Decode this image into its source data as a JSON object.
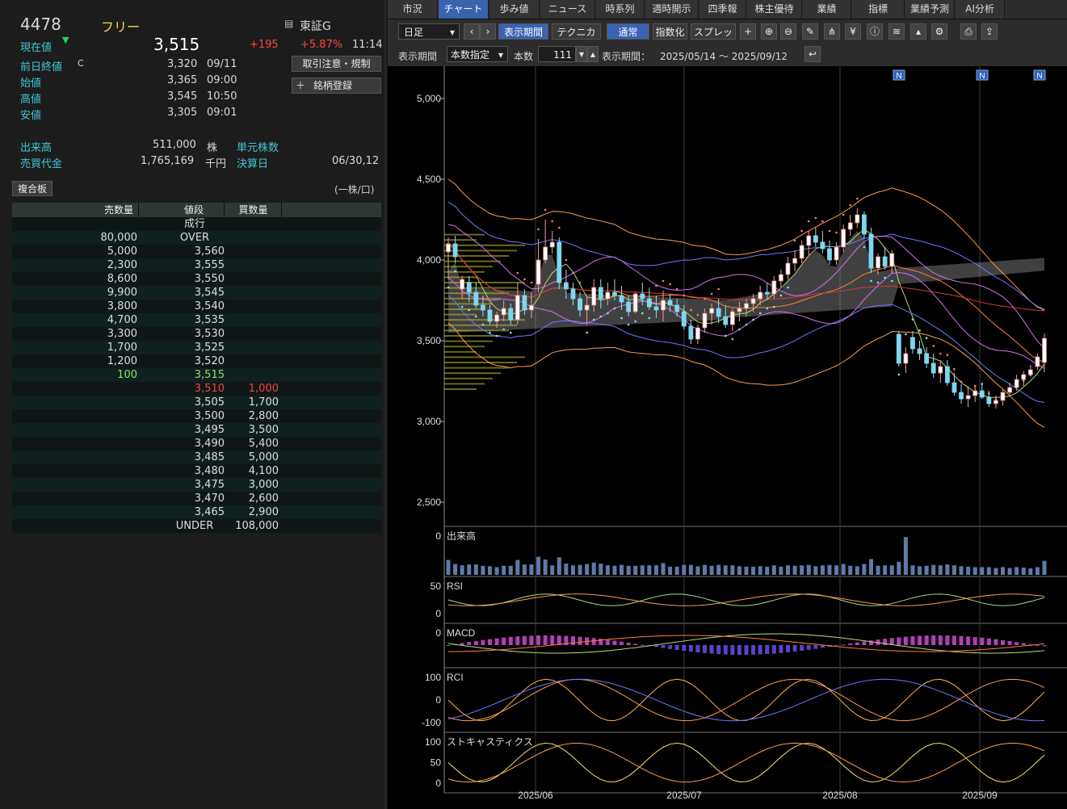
{
  "left": {
    "code": "4478",
    "name": "フリー",
    "market": "東証G",
    "stats": [
      {
        "label": "現在値",
        "value": "3,515",
        "change": "+195",
        "change_pct": "+5.87%",
        "time": "11:14"
      },
      {
        "label": "前日終値",
        "mark": "C",
        "value": "3,320",
        "time": "09/11"
      },
      {
        "label": "始値",
        "value": "3,365",
        "time": "09:00"
      },
      {
        "label": "高値",
        "value": "3,545",
        "time": "10:50"
      },
      {
        "label": "安値",
        "value": "3,305",
        "time": "09:01"
      }
    ],
    "volume": {
      "label": "出来高",
      "value": "511,000",
      "unit": "株"
    },
    "turnover": {
      "label": "売買代金",
      "value": "1,765,169",
      "unit": "千円"
    },
    "unit_shares": {
      "label": "単元株数"
    },
    "settlement": {
      "label": "決算日",
      "value": "06/30,12"
    },
    "buttons": [
      "取引注意・規制",
      "銘柄登録"
    ],
    "book_title": "複合板",
    "book_unit": "(一株/口)",
    "book_headers": [
      "売数量",
      "値段",
      "買数量"
    ],
    "book_rows": [
      {
        "sell": "",
        "price": "成行",
        "buy": ""
      },
      {
        "sell": "80,000",
        "price": "OVER",
        "buy": ""
      },
      {
        "sell": "5,000",
        "price": "3,560",
        "buy": ""
      },
      {
        "sell": "2,300",
        "price": "3,555",
        "buy": ""
      },
      {
        "sell": "8,600",
        "price": "3,550",
        "buy": ""
      },
      {
        "sell": "9,900",
        "price": "3,545",
        "buy": ""
      },
      {
        "sell": "3,800",
        "price": "3,540",
        "buy": ""
      },
      {
        "sell": "4,700",
        "price": "3,535",
        "buy": ""
      },
      {
        "sell": "3,300",
        "price": "3,530",
        "buy": ""
      },
      {
        "sell": "1,700",
        "price": "3,525",
        "buy": ""
      },
      {
        "sell": "1,200",
        "price": "3,520",
        "buy": ""
      },
      {
        "sell": "100",
        "price": "3,515",
        "buy": ""
      },
      {
        "sell": "",
        "price": "3,510",
        "buy": "1,000"
      },
      {
        "sell": "",
        "price": "3,505",
        "buy": "1,700"
      },
      {
        "sell": "",
        "price": "3,500",
        "buy": "2,800"
      },
      {
        "sell": "",
        "price": "3,495",
        "buy": "3,500"
      },
      {
        "sell": "",
        "price": "3,490",
        "buy": "5,400"
      },
      {
        "sell": "",
        "price": "3,485",
        "buy": "5,000"
      },
      {
        "sell": "",
        "price": "3,480",
        "buy": "4,100"
      },
      {
        "sell": "",
        "price": "3,475",
        "buy": "3,000"
      },
      {
        "sell": "",
        "price": "3,470",
        "buy": "2,600"
      },
      {
        "sell": "",
        "price": "3,465",
        "buy": "2,900"
      },
      {
        "sell": "",
        "price": "UNDER",
        "buy": "108,000"
      }
    ]
  },
  "tabs": [
    "市況",
    "チャート",
    "歩み値",
    "ニュース",
    "時系列",
    "適時開示",
    "四季報",
    "株主優待",
    "業績",
    "指標",
    "業績予測",
    "AI分析"
  ],
  "toolbar": {
    "period_select": "日足",
    "buttons": [
      "表示期間",
      "テクニカル",
      "通常",
      "指数化",
      "スプレッド"
    ]
  },
  "secondbar": {
    "range_label": "表示期間",
    "range_mode": "本数指定",
    "count_label": "本数",
    "count_value": "111",
    "display_label": "表示期間：",
    "display_value": "2025/05/14 ～ 2025/09/12"
  },
  "chart_data": {
    "type": "line",
    "price_ticks": [
      "5,000",
      "4,500",
      "4,000",
      "3,500",
      "3,000",
      "2,500"
    ],
    "x_labels": [
      "2025/06",
      "2025/07",
      "2025/08",
      "2025/09"
    ],
    "subpanels": [
      {
        "name": "出来高",
        "ticks": [
          "0"
        ]
      },
      {
        "name": "RSI",
        "ticks": [
          "50",
          "0"
        ]
      },
      {
        "name": "MACD",
        "ticks": [
          "0"
        ]
      },
      {
        "name": "RCI",
        "ticks": [
          "100",
          "0",
          "-100"
        ]
      },
      {
        "name": "ストキャスティクス",
        "ticks": [
          "100",
          "50",
          "0"
        ]
      }
    ],
    "news_markers": [
      "N",
      "N",
      "N"
    ],
    "candles": [
      {
        "x": "05/14",
        "o": 4050,
        "h": 4140,
        "l": 3880,
        "c": 4100
      },
      {
        "x": "05/15",
        "o": 4100,
        "h": 4150,
        "l": 3980,
        "c": 4020
      },
      {
        "x": "05/16",
        "o": 3820,
        "h": 3900,
        "l": 3760,
        "c": 3880
      },
      {
        "x": "05/19",
        "o": 3860,
        "h": 3900,
        "l": 3740,
        "c": 3800
      },
      {
        "x": "05/20",
        "o": 3800,
        "h": 3860,
        "l": 3700,
        "c": 3720
      },
      {
        "x": "05/21",
        "o": 3720,
        "h": 3780,
        "l": 3650,
        "c": 3690
      },
      {
        "x": "05/22",
        "o": 3690,
        "h": 3720,
        "l": 3600,
        "c": 3620
      },
      {
        "x": "05/23",
        "o": 3620,
        "h": 3680,
        "l": 3580,
        "c": 3660
      },
      {
        "x": "05/26",
        "o": 3660,
        "h": 3750,
        "l": 3620,
        "c": 3700
      },
      {
        "x": "05/27",
        "o": 3700,
        "h": 3730,
        "l": 3600,
        "c": 3630
      },
      {
        "x": "05/28",
        "o": 3630,
        "h": 3860,
        "l": 3600,
        "c": 3780
      },
      {
        "x": "05/29",
        "o": 3780,
        "h": 3820,
        "l": 3660,
        "c": 3690
      },
      {
        "x": "05/30",
        "o": 3690,
        "h": 3800,
        "l": 3640,
        "c": 3720
      },
      {
        "x": "06/02",
        "o": 3850,
        "h": 4130,
        "l": 3800,
        "c": 4000
      },
      {
        "x": "06/03",
        "o": 4000,
        "h": 4250,
        "l": 3980,
        "c": 4080
      },
      {
        "x": "06/04",
        "o": 4080,
        "h": 4180,
        "l": 4040,
        "c": 4110
      },
      {
        "x": "06/05",
        "o": 4110,
        "h": 4140,
        "l": 3820,
        "c": 3860
      },
      {
        "x": "06/06",
        "o": 3860,
        "h": 3940,
        "l": 3760,
        "c": 3820
      },
      {
        "x": "06/09",
        "o": 3820,
        "h": 3860,
        "l": 3720,
        "c": 3760
      },
      {
        "x": "06/10",
        "o": 3760,
        "h": 3800,
        "l": 3650,
        "c": 3690
      },
      {
        "x": "06/11",
        "o": 3690,
        "h": 3770,
        "l": 3600,
        "c": 3720
      },
      {
        "x": "06/12",
        "o": 3720,
        "h": 3880,
        "l": 3680,
        "c": 3830
      },
      {
        "x": "06/13",
        "o": 3830,
        "h": 3880,
        "l": 3700,
        "c": 3760
      },
      {
        "x": "06/16",
        "o": 3760,
        "h": 3860,
        "l": 3720,
        "c": 3800
      },
      {
        "x": "06/17",
        "o": 3800,
        "h": 3880,
        "l": 3750,
        "c": 3780
      },
      {
        "x": "06/18",
        "o": 3780,
        "h": 3840,
        "l": 3690,
        "c": 3740
      },
      {
        "x": "06/19",
        "o": 3740,
        "h": 3780,
        "l": 3650,
        "c": 3680
      },
      {
        "x": "06/20",
        "o": 3680,
        "h": 3800,
        "l": 3670,
        "c": 3790
      },
      {
        "x": "06/23",
        "o": 3790,
        "h": 3860,
        "l": 3720,
        "c": 3760
      },
      {
        "x": "06/24",
        "o": 3760,
        "h": 3830,
        "l": 3690,
        "c": 3710
      },
      {
        "x": "06/25",
        "o": 3710,
        "h": 3780,
        "l": 3640,
        "c": 3690
      },
      {
        "x": "06/26",
        "o": 3690,
        "h": 3810,
        "l": 3620,
        "c": 3750
      },
      {
        "x": "06/27",
        "o": 3750,
        "h": 3790,
        "l": 3680,
        "c": 3720
      },
      {
        "x": "06/30",
        "o": 3720,
        "h": 3760,
        "l": 3650,
        "c": 3680
      },
      {
        "x": "07/01",
        "o": 3680,
        "h": 3720,
        "l": 3570,
        "c": 3590
      },
      {
        "x": "07/02",
        "o": 3590,
        "h": 3630,
        "l": 3480,
        "c": 3510
      },
      {
        "x": "07/03",
        "o": 3510,
        "h": 3600,
        "l": 3480,
        "c": 3580
      },
      {
        "x": "07/04",
        "o": 3580,
        "h": 3700,
        "l": 3550,
        "c": 3670
      },
      {
        "x": "07/07",
        "o": 3670,
        "h": 3730,
        "l": 3600,
        "c": 3700
      },
      {
        "x": "07/08",
        "o": 3700,
        "h": 3760,
        "l": 3610,
        "c": 3650
      },
      {
        "x": "07/09",
        "o": 3650,
        "h": 3720,
        "l": 3580,
        "c": 3600
      },
      {
        "x": "07/10",
        "o": 3600,
        "h": 3700,
        "l": 3560,
        "c": 3680
      },
      {
        "x": "07/11",
        "o": 3680,
        "h": 3740,
        "l": 3620,
        "c": 3700
      },
      {
        "x": "07/14",
        "o": 3700,
        "h": 3760,
        "l": 3650,
        "c": 3730
      },
      {
        "x": "07/15",
        "o": 3730,
        "h": 3790,
        "l": 3680,
        "c": 3760
      },
      {
        "x": "07/16",
        "o": 3760,
        "h": 3840,
        "l": 3720,
        "c": 3800
      },
      {
        "x": "07/17",
        "o": 3800,
        "h": 3860,
        "l": 3750,
        "c": 3790
      },
      {
        "x": "07/18",
        "o": 3790,
        "h": 3900,
        "l": 3760,
        "c": 3870
      },
      {
        "x": "07/21",
        "o": 3870,
        "h": 3940,
        "l": 3830,
        "c": 3910
      },
      {
        "x": "07/22",
        "o": 3910,
        "h": 4020,
        "l": 3880,
        "c": 3980
      },
      {
        "x": "07/23",
        "o": 3980,
        "h": 4060,
        "l": 3930,
        "c": 4010
      },
      {
        "x": "07/24",
        "o": 4010,
        "h": 4120,
        "l": 3980,
        "c": 4090
      },
      {
        "x": "07/25",
        "o": 4090,
        "h": 4180,
        "l": 4030,
        "c": 4150
      },
      {
        "x": "07/28",
        "o": 4150,
        "h": 4200,
        "l": 4080,
        "c": 4110
      },
      {
        "x": "07/29",
        "o": 4110,
        "h": 4180,
        "l": 4040,
        "c": 4070
      },
      {
        "x": "07/30",
        "o": 4070,
        "h": 4120,
        "l": 3970,
        "c": 4000
      },
      {
        "x": "07/31",
        "o": 4000,
        "h": 4110,
        "l": 3970,
        "c": 4080
      },
      {
        "x": "08/01",
        "o": 4080,
        "h": 4220,
        "l": 4050,
        "c": 4190
      },
      {
        "x": "08/04",
        "o": 4190,
        "h": 4280,
        "l": 4150,
        "c": 4230
      },
      {
        "x": "08/05",
        "o": 4230,
        "h": 4320,
        "l": 4200,
        "c": 4280
      },
      {
        "x": "08/06",
        "o": 4280,
        "h": 4300,
        "l": 4130,
        "c": 4160
      },
      {
        "x": "08/07",
        "o": 4160,
        "h": 4200,
        "l": 3920,
        "c": 3950
      },
      {
        "x": "08/08",
        "o": 3950,
        "h": 4040,
        "l": 3910,
        "c": 4020
      },
      {
        "x": "08/12",
        "o": 4020,
        "h": 4080,
        "l": 3940,
        "c": 3960
      },
      {
        "x": "08/13",
        "o": 3960,
        "h": 4060,
        "l": 3920,
        "c": 4040
      },
      {
        "x": "08/14",
        "o": 3540,
        "h": 3560,
        "l": 3340,
        "c": 3360
      },
      {
        "x": "08/15",
        "o": 3360,
        "h": 3460,
        "l": 3300,
        "c": 3420
      },
      {
        "x": "08/18",
        "o": 3520,
        "h": 3560,
        "l": 3420,
        "c": 3450
      },
      {
        "x": "08/19",
        "o": 3450,
        "h": 3500,
        "l": 3380,
        "c": 3420
      },
      {
        "x": "08/20",
        "o": 3420,
        "h": 3460,
        "l": 3330,
        "c": 3360
      },
      {
        "x": "08/21",
        "o": 3360,
        "h": 3420,
        "l": 3270,
        "c": 3300
      },
      {
        "x": "08/22",
        "o": 3300,
        "h": 3380,
        "l": 3240,
        "c": 3340
      },
      {
        "x": "08/25",
        "o": 3340,
        "h": 3380,
        "l": 3220,
        "c": 3240
      },
      {
        "x": "08/26",
        "o": 3240,
        "h": 3300,
        "l": 3160,
        "c": 3180
      },
      {
        "x": "08/27",
        "o": 3180,
        "h": 3230,
        "l": 3110,
        "c": 3140
      },
      {
        "x": "08/28",
        "o": 3140,
        "h": 3200,
        "l": 3090,
        "c": 3160
      },
      {
        "x": "08/29",
        "o": 3160,
        "h": 3220,
        "l": 3120,
        "c": 3190
      },
      {
        "x": "09/01",
        "o": 3190,
        "h": 3240,
        "l": 3140,
        "c": 3150
      },
      {
        "x": "09/02",
        "o": 3150,
        "h": 3190,
        "l": 3090,
        "c": 3110
      },
      {
        "x": "09/03",
        "o": 3110,
        "h": 3160,
        "l": 3080,
        "c": 3130
      },
      {
        "x": "09/04",
        "o": 3130,
        "h": 3200,
        "l": 3100,
        "c": 3180
      },
      {
        "x": "09/05",
        "o": 3180,
        "h": 3240,
        "l": 3160,
        "c": 3210
      },
      {
        "x": "09/08",
        "o": 3210,
        "h": 3290,
        "l": 3190,
        "c": 3260
      },
      {
        "x": "09/09",
        "o": 3260,
        "h": 3310,
        "l": 3220,
        "c": 3290
      },
      {
        "x": "09/10",
        "o": 3290,
        "h": 3350,
        "l": 3280,
        "c": 3320
      },
      {
        "x": "09/11",
        "o": 3340,
        "h": 3420,
        "l": 3320,
        "c": 3400
      },
      {
        "x": "09/12",
        "o": 3365,
        "h": 3545,
        "l": 3305,
        "c": 3515
      }
    ]
  }
}
